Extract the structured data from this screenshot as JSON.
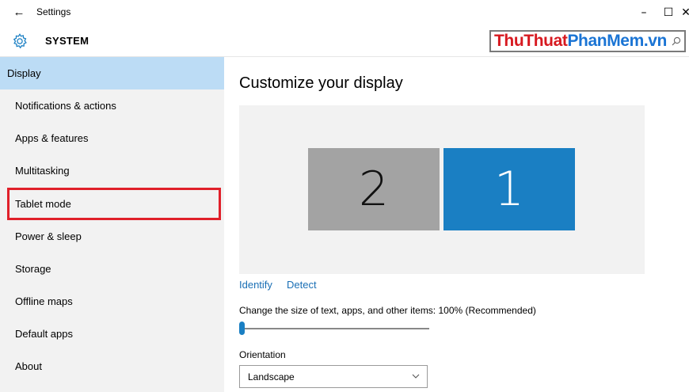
{
  "window": {
    "title": "Settings",
    "back_glyph": "←",
    "min_glyph": "–",
    "max_glyph": "☐",
    "close_glyph": "✕"
  },
  "header": {
    "icon": "gear-icon",
    "title": "SYSTEM",
    "brand_part1": "ThuThuat",
    "brand_part2": "PhanMem.vn",
    "search_icon": "search-icon"
  },
  "sidebar": {
    "items": [
      {
        "label": "Display"
      },
      {
        "label": "Notifications & actions"
      },
      {
        "label": "Apps & features"
      },
      {
        "label": "Multitasking"
      },
      {
        "label": "Tablet mode"
      },
      {
        "label": "Power & sleep"
      },
      {
        "label": "Storage"
      },
      {
        "label": "Offline maps"
      },
      {
        "label": "Default apps"
      },
      {
        "label": "About"
      }
    ],
    "selected_index": 0,
    "highlighted_index": 4
  },
  "main": {
    "title": "Customize your display",
    "monitors": [
      {
        "number": "2"
      },
      {
        "number": "1"
      }
    ],
    "identify_label": "Identify",
    "detect_label": "Detect",
    "scale_label": "Change the size of text, apps, and other items: 100% (Recommended)",
    "scale_slider_fraction": 0.0,
    "orientation_label": "Orientation",
    "orientation_value": "Landscape"
  },
  "colors": {
    "accent": "#1a7fc3",
    "selected_bg": "#bcdcf5",
    "highlight_border": "#e0202a",
    "sidebar_bg": "#f2f2f2",
    "brand_red": "#d71920",
    "brand_blue": "#1a74d4"
  }
}
